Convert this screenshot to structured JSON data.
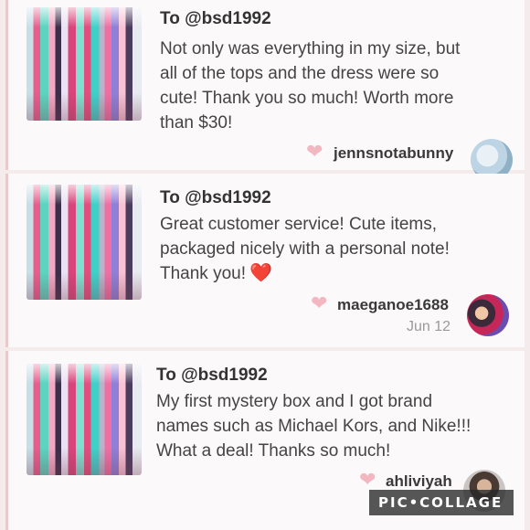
{
  "reviews": [
    {
      "to": "To @bsd1992",
      "lines": [
        "Not only was everything in my size, but",
        "all of the tops and the dress were so",
        "cute! Thank you so much! Worth more",
        "than $30!"
      ],
      "username": "jennsnotabunny",
      "date": "",
      "icons": {
        "thumbnail": "clothing-rack-photo",
        "like": "heart-icon",
        "avatar": "avatar-photo"
      }
    },
    {
      "to": "To @bsd1992",
      "lines": [
        "Great customer service! Cute items,",
        "packaged nicely with a personal note!",
        "Thank you!"
      ],
      "emoji": "❤️",
      "username": "maeganoe1688",
      "date": "Jun 12",
      "icons": {
        "thumbnail": "clothing-rack-photo",
        "like": "heart-icon",
        "avatar": "avatar-photo"
      }
    },
    {
      "to": "To @bsd1992",
      "lines": [
        "My first mystery box and I got brand",
        "names such as Michael Kors, and Nike!!!",
        "What a deal! Thanks so much!"
      ],
      "username": "ahliviyah",
      "date": "",
      "icons": {
        "thumbnail": "clothing-rack-photo",
        "like": "heart-icon",
        "avatar": "avatar-photo"
      }
    }
  ],
  "watermark": "PIC•COLLAGE",
  "colors": {
    "background": "#f4ecec",
    "card": "#fbf9f9",
    "like_heart": "#f3b7c2",
    "emoji_heart": "#e0243a",
    "username": "#3a3a3a",
    "date": "#9a9a9a"
  }
}
